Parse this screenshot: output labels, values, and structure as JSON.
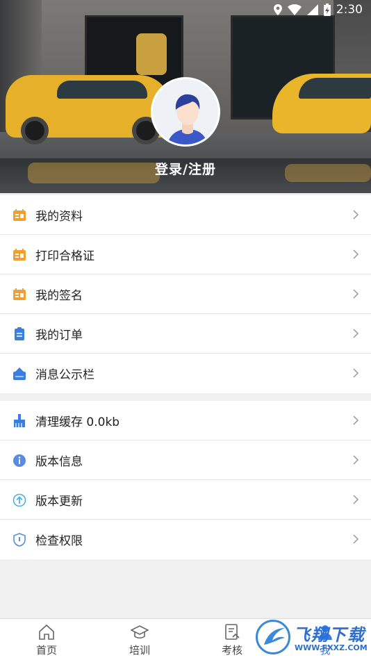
{
  "status_bar": {
    "time": "2:30"
  },
  "profile": {
    "login_text": "登录/注册"
  },
  "menu_group_1": [
    {
      "label": "我的资料",
      "icon": "profile-card-icon",
      "color": "#f0a030"
    },
    {
      "label": "打印合格证",
      "icon": "certificate-icon",
      "color": "#f0a030"
    },
    {
      "label": "我的签名",
      "icon": "signature-icon",
      "color": "#f0a030"
    },
    {
      "label": "我的订单",
      "icon": "order-clipboard-icon",
      "color": "#3a7ee0"
    },
    {
      "label": "消息公示栏",
      "icon": "bulletin-icon",
      "color": "#3a7ee0"
    }
  ],
  "menu_group_2": [
    {
      "label": "清理缓存 0.0kb",
      "icon": "broom-icon",
      "color": "#3a7ee0"
    },
    {
      "label": "版本信息",
      "icon": "info-icon",
      "color": "#5b8be0"
    },
    {
      "label": "版本更新",
      "icon": "upload-arrow-icon",
      "color": "#4ab0e8"
    },
    {
      "label": "检查权限",
      "icon": "shield-icon",
      "color": "#5b8be0"
    }
  ],
  "bottom_nav": [
    {
      "label": "首页",
      "icon": "home-icon"
    },
    {
      "label": "培训",
      "icon": "graduation-cap-icon"
    },
    {
      "label": "考核",
      "icon": "exam-icon"
    },
    {
      "label": "我",
      "icon": "person-icon"
    }
  ],
  "watermark": {
    "text": "飞翔下载",
    "url": "WWW.FXXZ.COM"
  },
  "colors": {
    "accent": "#2f7be8",
    "orange_icon": "#f0a030"
  }
}
